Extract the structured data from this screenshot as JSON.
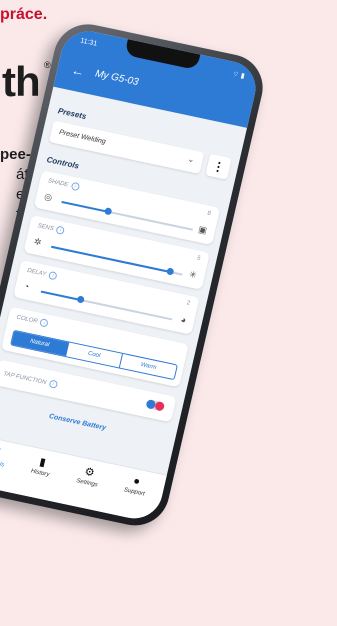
{
  "promo": {
    "top_text": "práce.",
    "brand": "th",
    "reg": "®",
    "bold_line": "pee-",
    "lines": [
      "áte",
      "e",
      "te",
      "e"
    ]
  },
  "status": {
    "time": "11:31",
    "right": "⌔ ▮"
  },
  "appbar": {
    "title": "My G5-03"
  },
  "presets": {
    "label": "Presets",
    "value": "Preset Welding"
  },
  "controls": {
    "label": "Controls"
  },
  "shade": {
    "label": "SHADE",
    "value": "8",
    "level": 0.35
  },
  "sens": {
    "label": "SENS",
    "value": "5",
    "level": 0.9
  },
  "delay": {
    "label": "DELAY",
    "value": "2",
    "level": 0.3
  },
  "color": {
    "label": "COLOR",
    "options": [
      "Natural",
      "Cool",
      "Warm"
    ],
    "selected": "Natural"
  },
  "tap": {
    "label": "TAP FUNCTION"
  },
  "conserve": {
    "label": "Conserve Battery"
  },
  "tabs": [
    {
      "label": "Controls",
      "icon": "sliders-icon"
    },
    {
      "label": "History",
      "icon": "bar-chart-icon"
    },
    {
      "label": "Settings",
      "icon": "gear-icon"
    },
    {
      "label": "Support",
      "icon": "help-icon"
    }
  ],
  "colors": {
    "accent": "#2e7bd6",
    "background": "#fbe9ea",
    "promo_red": "#c8102e"
  }
}
